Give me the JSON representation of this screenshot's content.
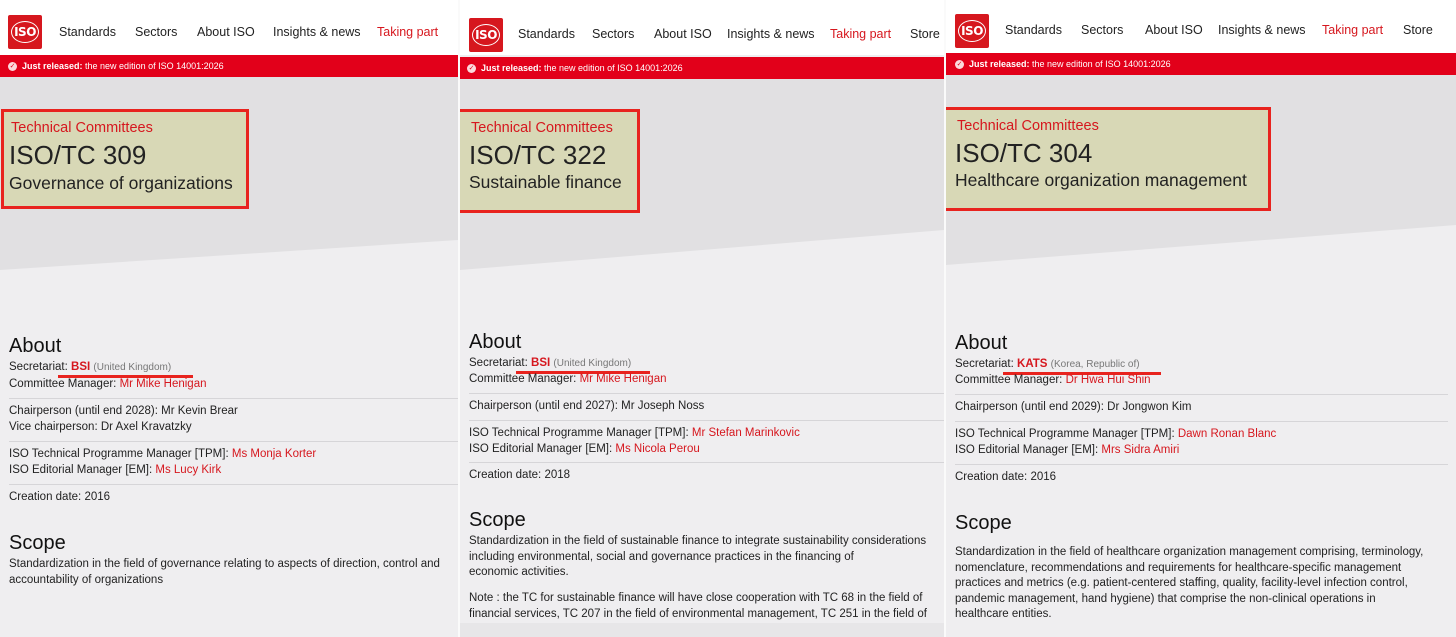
{
  "nav": {
    "logo_text": "ISO",
    "items": [
      "Standards",
      "Sectors",
      "About ISO",
      "Insights & news",
      "Taking part",
      "Store"
    ]
  },
  "banner": {
    "bold": "Just released:",
    "text": " the new edition of ISO 14001:2026"
  },
  "common": {
    "tc_label": "Technical Committees",
    "about": "About",
    "secretariat": "Secretariat:",
    "committee_manager": "Committee Manager:",
    "tpm": "ISO Technical Programme Manager [TPM]:",
    "em": "ISO Editorial Manager [EM]:",
    "creation": "Creation date:",
    "scope": "Scope"
  },
  "panels": [
    {
      "tc_number": "ISO/TC 309",
      "tc_name": "Governance of organizations",
      "secretariat": "BSI",
      "country": "(United Kingdom)",
      "manager": "Mr Mike Henigan",
      "chair": "Chairperson (until end 2028): Mr Kevin Brear",
      "vice_chair": "Vice chairperson: Dr Axel Kravatzky",
      "tpm": "Ms Monja Korter",
      "em": "Ms Lucy Kirk",
      "creation_year": "2016",
      "scope_lines": [
        "Standardization in the field of governance relating to aspects of direction, control and",
        "accountability of organizations"
      ]
    },
    {
      "tc_number": "ISO/TC 322",
      "tc_name": "Sustainable finance",
      "secretariat": "BSI",
      "country": "(United Kingdom)",
      "manager": "Mr Mike Henigan",
      "chair": "Chairperson (until end 2027): Mr Joseph Noss",
      "tpm": "Mr Stefan Marinkovic",
      "em": "Ms Nicola Perou",
      "creation_year": "2018",
      "scope_lines": [
        "Standardization in the field of sustainable finance to integrate sustainability considerations",
        "including environmental, social and governance practices in the financing of",
        "economic activities."
      ],
      "note_lines": [
        "Note : the TC for sustainable finance will have close cooperation with TC 68 in the field of",
        "financial services, TC 207 in the field of environmental management, TC 251 in the field of"
      ]
    },
    {
      "tc_number": "ISO/TC 304",
      "tc_name": "Healthcare organization management",
      "secretariat": "KATS",
      "country": "(Korea, Republic of)",
      "manager": "Dr Hwa Hui Shin",
      "chair": "Chairperson (until end 2029): Dr Jongwon Kim",
      "tpm": "Dawn Ronan Blanc",
      "em": "Mrs Sidra Amiri",
      "creation_year": "2016",
      "scope_lines": [
        "Standardization in the field of healthcare organization management comprising, terminology,",
        "nomenclature, recommendations and requirements for healthcare-specific management",
        "practices and metrics (e.g. patient-centered staffing, quality, facility-level infection control,",
        "pandemic management, hand hygiene) that comprise the non-clinical operations in",
        "healthcare entities."
      ]
    }
  ]
}
